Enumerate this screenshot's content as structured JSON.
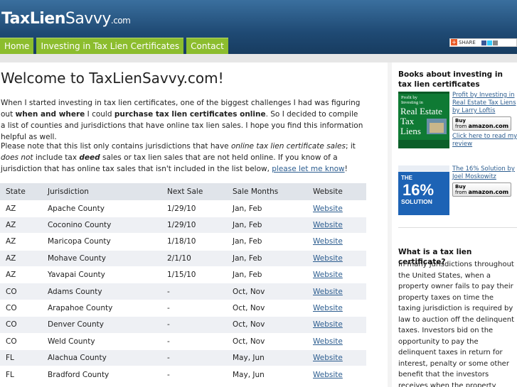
{
  "site": {
    "logo_bold": "TaxLien",
    "logo_light": "Savvy",
    "logo_domain": ".com"
  },
  "nav": {
    "items": [
      {
        "label": "Home"
      },
      {
        "label": "Investing in Tax Lien Certificates"
      },
      {
        "label": "Contact"
      }
    ]
  },
  "share": {
    "label": "SHARE"
  },
  "colors": {
    "header_top": "#3a6f9e",
    "header_bottom": "#173c60",
    "nav_green": "#8cbd2e",
    "link": "#2b5c8f",
    "table_header": "#e0e4ea",
    "table_alt_row": "#eef0f4"
  },
  "main": {
    "title": "Welcome to TaxLienSavvy.com!",
    "para1": {
      "t1": "When I started investing in tax lien certificates, one of the biggest challenges I had was figuring out ",
      "b1": "when and where",
      "t2": " I could ",
      "b2": "purchase tax lien certificates online",
      "t3": ". So I decided to compile a list of counties and jurisdictions that have online tax lien sales. I hope you find this information helpful as well."
    },
    "para2": {
      "t1": "Please note that this list only contains jurisdictions that have ",
      "i1": "online tax lien certificate sales",
      "t2": "; it ",
      "i2": "does not",
      "t3": " include tax ",
      "bi1": "deed",
      "t4": " sales or tax lien sales that are not held online. If you know of a jurisdiction that has online tax sales that isn't included in the list below, ",
      "link": "please let me know",
      "t5": "!"
    },
    "table": {
      "headers": [
        "State",
        "Jurisdiction",
        "Next Sale",
        "Sale Months",
        "Website"
      ],
      "rows": [
        [
          "AZ",
          "Apache County",
          "1/29/10",
          "Jan, Feb",
          "Website"
        ],
        [
          "AZ",
          "Coconino County",
          "1/29/10",
          "Jan, Feb",
          "Website"
        ],
        [
          "AZ",
          "Maricopa County",
          "1/18/10",
          "Jan, Feb",
          "Website"
        ],
        [
          "AZ",
          "Mohave County",
          "2/1/10",
          "Jan, Feb",
          "Website"
        ],
        [
          "AZ",
          "Yavapai County",
          "1/15/10",
          "Jan, Feb",
          "Website"
        ],
        [
          "CO",
          "Adams County",
          "-",
          "Oct, Nov",
          "Website"
        ],
        [
          "CO",
          "Arapahoe County",
          "-",
          "Oct, Nov",
          "Website"
        ],
        [
          "CO",
          "Denver County",
          "-",
          "Oct, Nov",
          "Website"
        ],
        [
          "CO",
          "Weld County",
          "-",
          "Oct, Nov",
          "Website"
        ],
        [
          "FL",
          "Alachua County",
          "-",
          "May, Jun",
          "Website"
        ],
        [
          "FL",
          "Bradford County",
          "-",
          "May, Jun",
          "Website"
        ]
      ]
    }
  },
  "sidebar": {
    "books_heading": "Books about investing in tax lien certificates",
    "books": [
      {
        "title": "Profit by Investing in Real Estate Tax Liens",
        "author": "by Larry Loftis",
        "cover_lines": [
          "Profit by",
          "Investing in",
          "Real Estate",
          "Tax",
          "Liens"
        ],
        "buy_label": "Buy",
        "from_label": "from",
        "store": "amazon.com",
        "review_link": "Click here to read my review"
      },
      {
        "title": "The 16% Solution by Joel Moskowitz",
        "cover_lines": [
          "THE",
          "16%",
          "SOLUTION"
        ],
        "buy_label": "Buy",
        "from_label": "from",
        "store": "amazon.com"
      }
    ],
    "whatis_heading": "What is a tax lien certificate?",
    "whatis_text": "In many jurisdictions throughout the United States, when a property owner fails to pay their property taxes on time the taxing jurisdiction is required by law to auction off the delinquent taxes. Investors bid on the opportunity to pay the delinquent taxes in return for interest, penalty or some other benefit that the investors receives when the property owner \"redeems\" the certificate."
  }
}
